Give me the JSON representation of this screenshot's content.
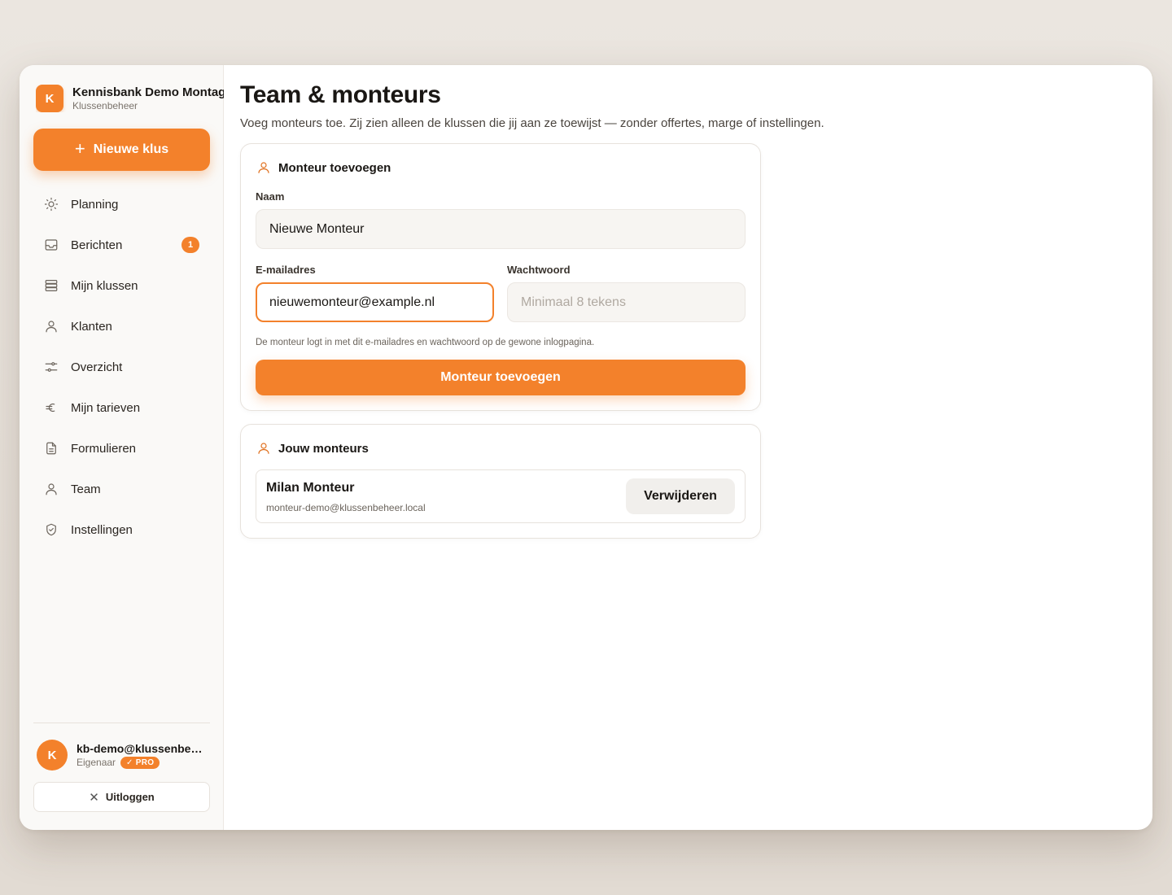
{
  "brand": {
    "logo_letter": "K",
    "name": "Kennisbank Demo Montage",
    "subtitle": "Klussenbeheer"
  },
  "sidebar": {
    "new_button": {
      "icon": "plus-icon",
      "label": "Nieuwe klus"
    },
    "items": [
      {
        "label": "Planning",
        "icon": "sun-icon"
      },
      {
        "label": "Berichten",
        "icon": "inbox-icon",
        "badge": "1"
      },
      {
        "label": "Mijn klussen",
        "icon": "stack-icon"
      },
      {
        "label": "Klanten",
        "icon": "user-icon"
      },
      {
        "label": "Overzicht",
        "icon": "sliders-icon"
      },
      {
        "label": "Mijn tarieven",
        "icon": "euro-icon"
      },
      {
        "label": "Formulieren",
        "icon": "document-icon"
      },
      {
        "label": "Team",
        "icon": "user-icon"
      },
      {
        "label": "Instellingen",
        "icon": "shield-icon"
      }
    ],
    "user": {
      "avatar_letter": "K",
      "email": "kb-demo@klussenbeheer.local",
      "role": "Eigenaar",
      "badge": "✓ PRO"
    },
    "logout_label": "Uitloggen"
  },
  "main": {
    "title": "Team & monteurs",
    "subtitle": "Voeg monteurs toe. Zij zien alleen de klussen die jij aan ze toewijst — zonder offertes, marge of instellingen.",
    "add_card": {
      "heading": "Monteur toevoegen",
      "name_label": "Naam",
      "name_value": "Nieuwe Monteur",
      "email_label": "E-mailadres",
      "email_value": "nieuwemonteur@example.nl",
      "password_label": "Wachtwoord",
      "password_placeholder": "Minimaal 8 tekens",
      "hint": "De monteur logt in met dit e-mailadres en wachtwoord op de gewone inlogpagina.",
      "submit_label": "Monteur toevoegen"
    },
    "list_card": {
      "heading": "Jouw monteurs",
      "members": [
        {
          "name": "Milan Monteur",
          "email": "monteur-demo@klussenbeheer.local",
          "action": "Verwijderen"
        }
      ]
    }
  },
  "colors": {
    "accent": "#f3812b",
    "background": "#e9e4de"
  }
}
